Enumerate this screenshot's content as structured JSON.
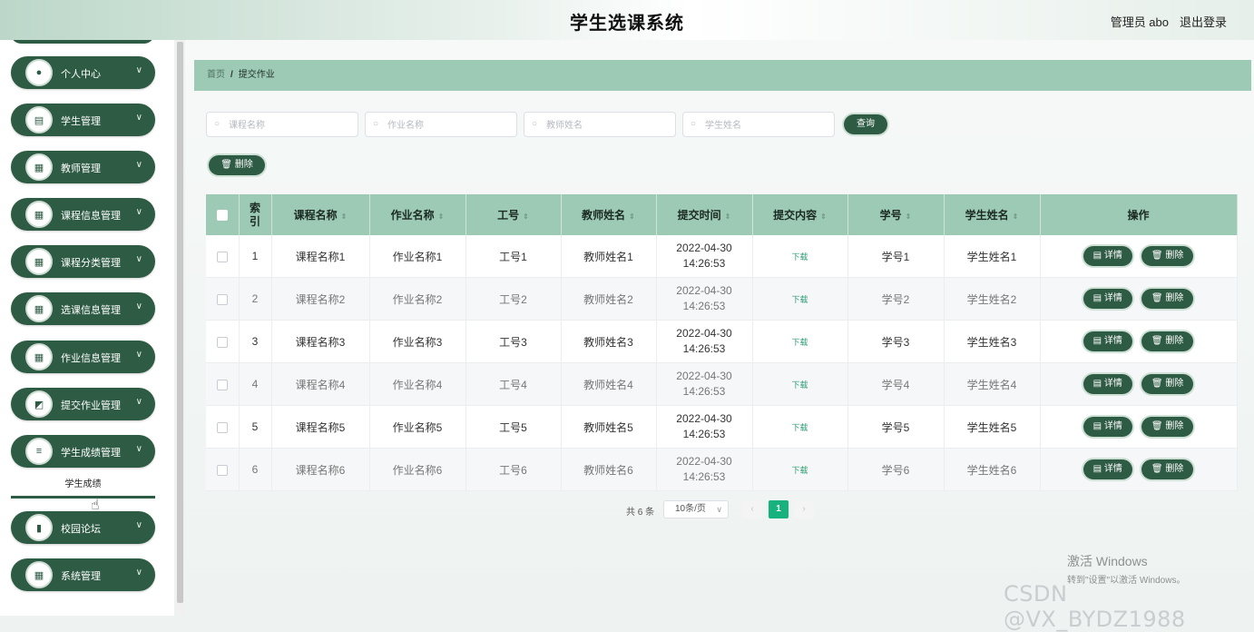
{
  "header": {
    "title": "学生选课系统",
    "user": "管理员 abo",
    "logout": "退出登录"
  },
  "sidebar": {
    "items": [
      {
        "label": "个人中心",
        "icon": "person-icon",
        "glyph": "●"
      },
      {
        "label": "学生管理",
        "icon": "clipboard-icon",
        "glyph": "▤"
      },
      {
        "label": "教师管理",
        "icon": "grid-icon",
        "glyph": "▦"
      },
      {
        "label": "课程信息管理",
        "icon": "grid-icon",
        "glyph": "▦"
      },
      {
        "label": "课程分类管理",
        "icon": "grid-icon",
        "glyph": "▦"
      },
      {
        "label": "选课信息管理",
        "icon": "grid-icon",
        "glyph": "▦"
      },
      {
        "label": "作业信息管理",
        "icon": "grid-icon",
        "glyph": "▦"
      },
      {
        "label": "提交作业管理",
        "icon": "chart-icon",
        "glyph": "◩"
      },
      {
        "label": "学生成绩管理",
        "icon": "list-icon",
        "glyph": "≡"
      },
      {
        "label": "校园论坛",
        "icon": "bar-chart-icon",
        "glyph": "▮"
      },
      {
        "label": "系统管理",
        "icon": "grid-icon",
        "glyph": "▦"
      }
    ],
    "sub_item": "学生成绩"
  },
  "breadcrumb": {
    "home": "首页",
    "sep": "/",
    "current": "提交作业"
  },
  "search": {
    "course_placeholder": "课程名称",
    "homework_placeholder": "作业名称",
    "teacher_placeholder": "教师姓名",
    "student_placeholder": "学生姓名",
    "query_label": "查询"
  },
  "toolbar": {
    "delete_label": "删除"
  },
  "table": {
    "headers": [
      "索引",
      "课程名称",
      "作业名称",
      "工号",
      "教师姓名",
      "提交时间",
      "提交内容",
      "学号",
      "学生姓名",
      "操作"
    ],
    "rows": [
      {
        "index": "1",
        "course": "课程名称1",
        "homework": "作业名称1",
        "teacher_id": "工号1",
        "teacher": "教师姓名1",
        "time": "2022-04-30 14:26:53",
        "content": "下载",
        "student_id": "学号1",
        "student": "学生姓名1"
      },
      {
        "index": "2",
        "course": "课程名称2",
        "homework": "作业名称2",
        "teacher_id": "工号2",
        "teacher": "教师姓名2",
        "time": "2022-04-30 14:26:53",
        "content": "下载",
        "student_id": "学号2",
        "student": "学生姓名2"
      },
      {
        "index": "3",
        "course": "课程名称3",
        "homework": "作业名称3",
        "teacher_id": "工号3",
        "teacher": "教师姓名3",
        "time": "2022-04-30 14:26:53",
        "content": "下载",
        "student_id": "学号3",
        "student": "学生姓名3"
      },
      {
        "index": "4",
        "course": "课程名称4",
        "homework": "作业名称4",
        "teacher_id": "工号4",
        "teacher": "教师姓名4",
        "time": "2022-04-30 14:26:53",
        "content": "下载",
        "student_id": "学号4",
        "student": "学生姓名4"
      },
      {
        "index": "5",
        "course": "课程名称5",
        "homework": "作业名称5",
        "teacher_id": "工号5",
        "teacher": "教师姓名5",
        "time": "2022-04-30 14:26:53",
        "content": "下载",
        "student_id": "学号5",
        "student": "学生姓名5"
      },
      {
        "index": "6",
        "course": "课程名称6",
        "homework": "作业名称6",
        "teacher_id": "工号6",
        "teacher": "教师姓名6",
        "time": "2022-04-30 14:26:53",
        "content": "下载",
        "student_id": "学号6",
        "student": "学生姓名6"
      }
    ],
    "detail_label": "详情",
    "delete_label": "删除"
  },
  "pagination": {
    "total": "共 6 条",
    "page_size": "10条/页",
    "current_page": "1",
    "prev": "‹",
    "next": "›"
  },
  "overlay": {
    "activation_title": "激活 Windows",
    "activation_sub": "转到\"设置\"以激活 Windows。",
    "watermark": "CSDN @VX_BYDZ1988"
  },
  "colors": {
    "accent": "#2e5b44",
    "header_bg": "#9dcab5",
    "page_active": "#18b27e"
  }
}
